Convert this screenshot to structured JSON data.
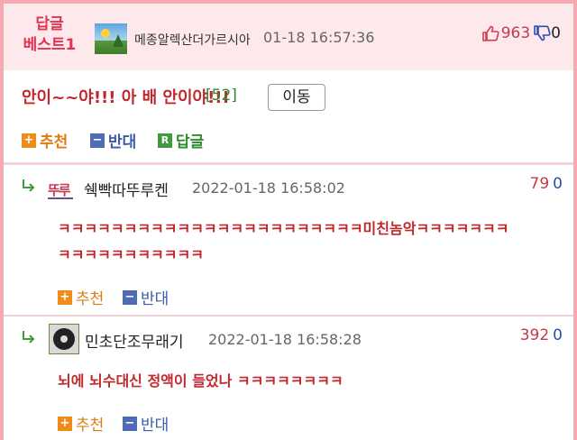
{
  "best_post": {
    "label_line1": "답글",
    "label_line2": "베스트1",
    "author": "메종알렉산더가르시아",
    "time": "01-18 16:57:36",
    "up_count": "963",
    "down_count": "0",
    "title": "안이~~야!!! 아 배 안이야!!!",
    "comment_count": "[52]",
    "move_label": "이동",
    "actions": {
      "recommend": "추천",
      "oppose": "반대",
      "reply": "답글"
    }
  },
  "comments": [
    {
      "avatar_text": "뚜루",
      "author": "쉑빡따뚜루켄",
      "time": "2022-01-18 16:58:02",
      "up": "79",
      "down": "0",
      "line1": "ㅋㅋㅋㅋㅋㅋㅋㅋㅋㅋㅋㅋㅋㅋㅋㅋㅋㅋㅋㅋㅋㅋㅋ미친놈악ㅋㅋㅋㅋㅋㅋㅋ",
      "line2": "ㅋㅋㅋㅋㅋㅋㅋㅋㅋㅋㅋ",
      "recommend": "추천",
      "oppose": "반대"
    },
    {
      "author": "민초단조무래기",
      "time": "2022-01-18 16:58:28",
      "up": "392",
      "down": "0",
      "line1": "뇌에 뇌수대신 정액이 들었나 ㅋㅋㅋㅋㅋㅋㅋㅋ",
      "recommend": "추천",
      "oppose": "반대"
    }
  ],
  "icons": {
    "thumb_up": "thumb-up-icon",
    "thumb_down": "thumb-down-icon",
    "reply_arrow": "reply-arrow-icon",
    "plus": "plus-square-icon",
    "minus": "minus-square-icon",
    "reply_badge": "reply-badge-icon"
  },
  "colors": {
    "accent_red": "#c0282e",
    "pink_border": "#f4a9b3",
    "recommend_orange": "#f08c1a",
    "oppose_blue": "#4f6bb5",
    "reply_green": "#3e9b3e"
  }
}
